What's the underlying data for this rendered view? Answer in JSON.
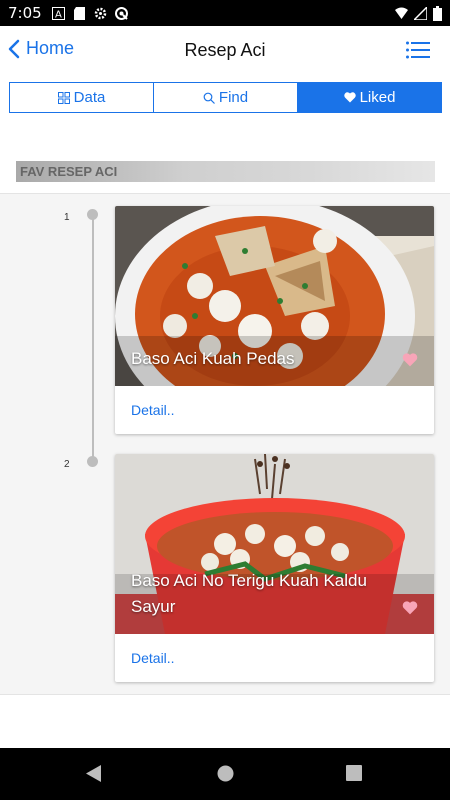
{
  "status_bar": {
    "time": "7:05",
    "left_icons": [
      "a-badge-icon",
      "sd-card-icon",
      "settings-icon",
      "vpn-icon"
    ],
    "right_icons": [
      "wifi-icon",
      "signal-icon",
      "battery-icon"
    ]
  },
  "header": {
    "back_label": "Home",
    "title": "Resep Aci"
  },
  "tabs": [
    {
      "label": "Data",
      "icon": "grid-icon",
      "active": false
    },
    {
      "label": "Find",
      "icon": "search-icon",
      "active": false
    },
    {
      "label": "Liked",
      "icon": "heart-icon",
      "active": true
    }
  ],
  "section": {
    "title": "FAV RESEP ACI"
  },
  "items": [
    {
      "number": "1",
      "title": "Baso Aci Kuah Pedas",
      "action": "Detail..",
      "liked": true
    },
    {
      "number": "2",
      "title": "Baso Aci No Terigu Kuah Kaldu Sayur",
      "action": "Detail..",
      "liked": true
    }
  ],
  "colors": {
    "accent": "#1a73e8",
    "heart": "#f8a5b8",
    "timeline": "#bdbdbd"
  }
}
